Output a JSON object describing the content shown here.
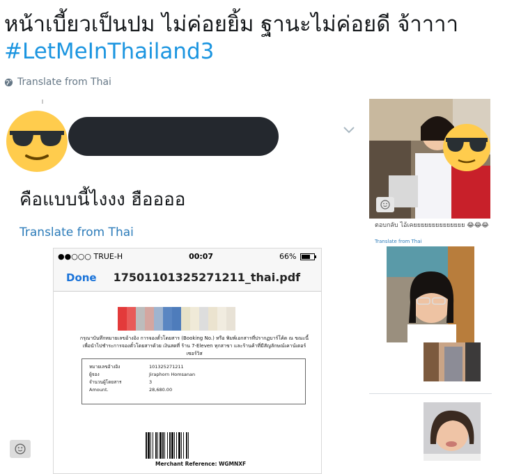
{
  "tweet": {
    "text": "หน้าเบี้ยวเป็นปม ไม่ค่อยยิ้ม ฐานะไม่ค่อยดี จ้าาาา",
    "hashtag": "#LetMeInThailand3",
    "translate_label": "Translate from Thai"
  },
  "embed": {
    "text": "คือแบบนี้ไงงง ฮืออออ",
    "translate_label": "Translate from Thai"
  },
  "phone": {
    "carrier": "●●○○○ TRUE-H",
    "time": "00:07",
    "battery": "66%",
    "done_label": "Done",
    "filename": "17501101325271211_thai.pdf",
    "paragraph": "กรุณาบันทึกหมายเลขอ้างอิง การจองตั๋วโดยสาร (Booking No.) หรือ พิมพ์เอกสารที่ปรากฏบาร์โค้ด ณ ขณะนี้ เพื่อนำไปชำระการจองตั๋วโดยสารด้วย เงินสดที่ ร้าน 7-Eleven ทุกสาขา และร้านค้าที่มีสัญลักษณ์เคาน์เตอร์เซอร์วิส",
    "rows": [
      {
        "key": "หมายเลขอ้างอิง",
        "value": "101325271211"
      },
      {
        "key": "ผู้จอง",
        "value": "Jiraphorn Homsanan"
      },
      {
        "key": "จำนวนผู้โดยสาร",
        "value": "3"
      },
      {
        "key": "Amount.",
        "value": "28,680.00"
      }
    ],
    "merchant": "Merchant Reference:   WGMNXF"
  },
  "right_column": {
    "cut_text": "ตอบกลับ ไอ้เคยยยยยยยยยยยยยย 😂😂😂",
    "translate_label": "Translate from Thai"
  },
  "colors": {
    "hashtag": "#1b95e0",
    "link": "#2b7bb9",
    "redaction": "#24282e",
    "emoji_yellow": "#ffcc4d"
  },
  "icons": [
    "globe-icon",
    "sunglasses-emoji-icon",
    "chevron-down-icon",
    "smiley-icon"
  ]
}
